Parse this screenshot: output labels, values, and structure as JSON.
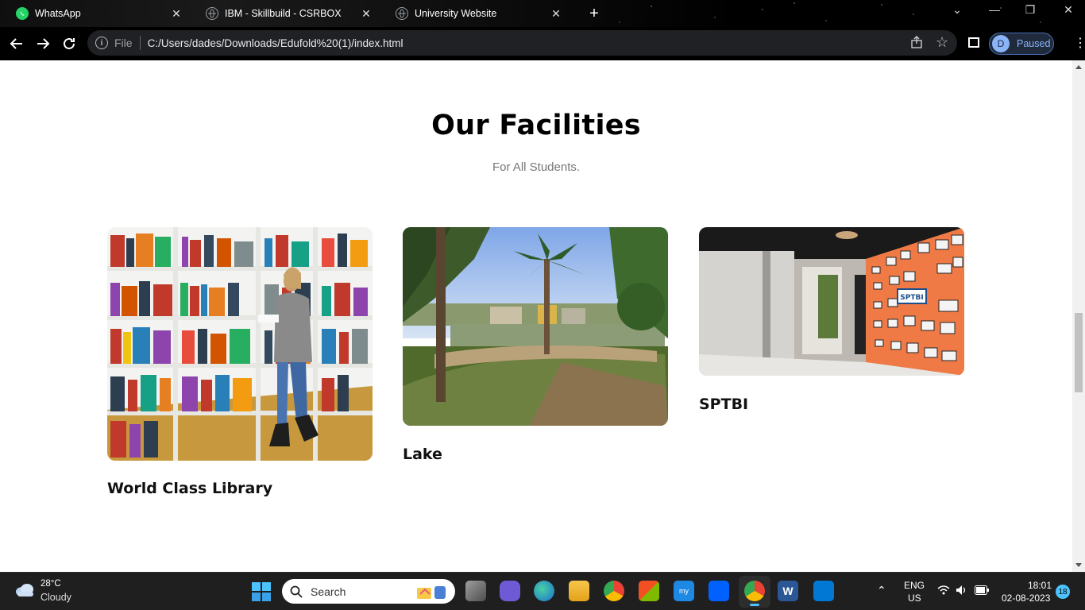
{
  "browser": {
    "tabs": [
      {
        "title": "WhatsApp",
        "icon": "whatsapp-icon",
        "color": "#25d366"
      },
      {
        "title": "IBM - Skillbuild - CSRBOX",
        "icon": "globe-icon",
        "color": "#9aa0a6"
      },
      {
        "title": "University Website",
        "icon": "globe-icon",
        "color": "#9aa0a6"
      }
    ],
    "url_scheme": "File",
    "url": "C:/Users/dades/Downloads/Edufold%20(1)/index.html",
    "profile": {
      "initial": "D",
      "status": "Paused"
    }
  },
  "page": {
    "heading": "Our Facilities",
    "subheading": "For All Students.",
    "cards": [
      {
        "title": "World Class Library",
        "image": "library-photo"
      },
      {
        "title": "Lake",
        "image": "lake-photo"
      },
      {
        "title": "SPTBI",
        "image": "sptbi-photo"
      }
    ]
  },
  "taskbar": {
    "weather": {
      "temp": "28°C",
      "condition": "Cloudy"
    },
    "search_label": "Search",
    "lang": {
      "line1": "ENG",
      "line2": "US"
    },
    "clock": {
      "time": "18:01",
      "date": "02-08-2023"
    },
    "notification_count": "18"
  },
  "colors": {
    "accent": "#8ab4f8",
    "sptbi_wall": "#f07a45",
    "page_bg": "#ffffff"
  }
}
